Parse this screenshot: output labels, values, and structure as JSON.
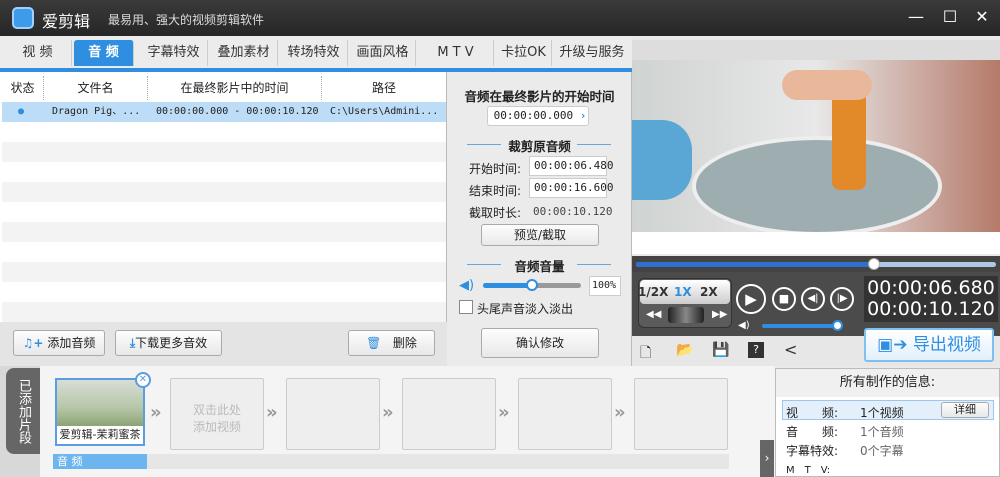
{
  "app": {
    "name": "爱剪辑",
    "slogan": "最易用、强大的视频剪辑软件",
    "minimize": "—",
    "maximize": "☐",
    "close": "✕"
  },
  "tabs": [
    {
      "label": "视 频"
    },
    {
      "label": "音 频",
      "active": true
    },
    {
      "label": "字幕特效"
    },
    {
      "label": "叠加素材"
    },
    {
      "label": "转场特效"
    },
    {
      "label": "画面风格"
    },
    {
      "label": "M T V"
    },
    {
      "label": "卡拉OK"
    },
    {
      "label": "升级与服务"
    }
  ],
  "table": {
    "headers": [
      "状态",
      "文件名",
      "在最终影片中的时间",
      "路径"
    ],
    "rows": [
      {
        "status": "●",
        "filename": "Dragon Pig、...",
        "time": "00:00:00.000 - 00:00:10.120",
        "path": "C:\\Users\\Admini..."
      }
    ]
  },
  "buttons": {
    "add_audio": "添加音频",
    "download": "下载更多音效",
    "delete": "删除"
  },
  "settings": {
    "start_title": "音频在最终影片的开始时间",
    "start_value": "00:00:00.000",
    "trim_title": "裁剪原音频",
    "start_label": "开始时间:",
    "start_time": "00:00:06.480",
    "end_label": "结束时间:",
    "end_time": "00:00:16.600",
    "duration_label": "截取时长:",
    "duration": "00:00:10.120",
    "preview_btn": "预览/截取",
    "volume_title": "音频音量",
    "volume": "100%",
    "volume_fraction": 0.5,
    "fade_label": "头尾声音淡入淡出",
    "confirm_btn": "确认修改"
  },
  "player": {
    "progress_fraction": 0.66,
    "speeds": [
      "1/2X",
      "1X",
      "2X"
    ],
    "current_time": "00:00:06.680",
    "total_time": "00:00:10.120",
    "volume_fraction": 1.0,
    "export": "导出视频"
  },
  "timeline": {
    "side_label": "已添加片段",
    "clip_name": "爱剪辑-茉莉蜜茶",
    "add_hint": "双击此处添加视频",
    "audio_track": "音 频"
  },
  "info": {
    "title": "所有制作的信息:",
    "rows": [
      {
        "k": "视　　频:",
        "v": "1个视频"
      },
      {
        "k": "音　　频:",
        "v": "1个音频"
      },
      {
        "k": "字幕特效:",
        "v": "0个字幕"
      },
      {
        "k": "M　T　V:",
        "v": ""
      }
    ],
    "detail_btn": "详细"
  }
}
